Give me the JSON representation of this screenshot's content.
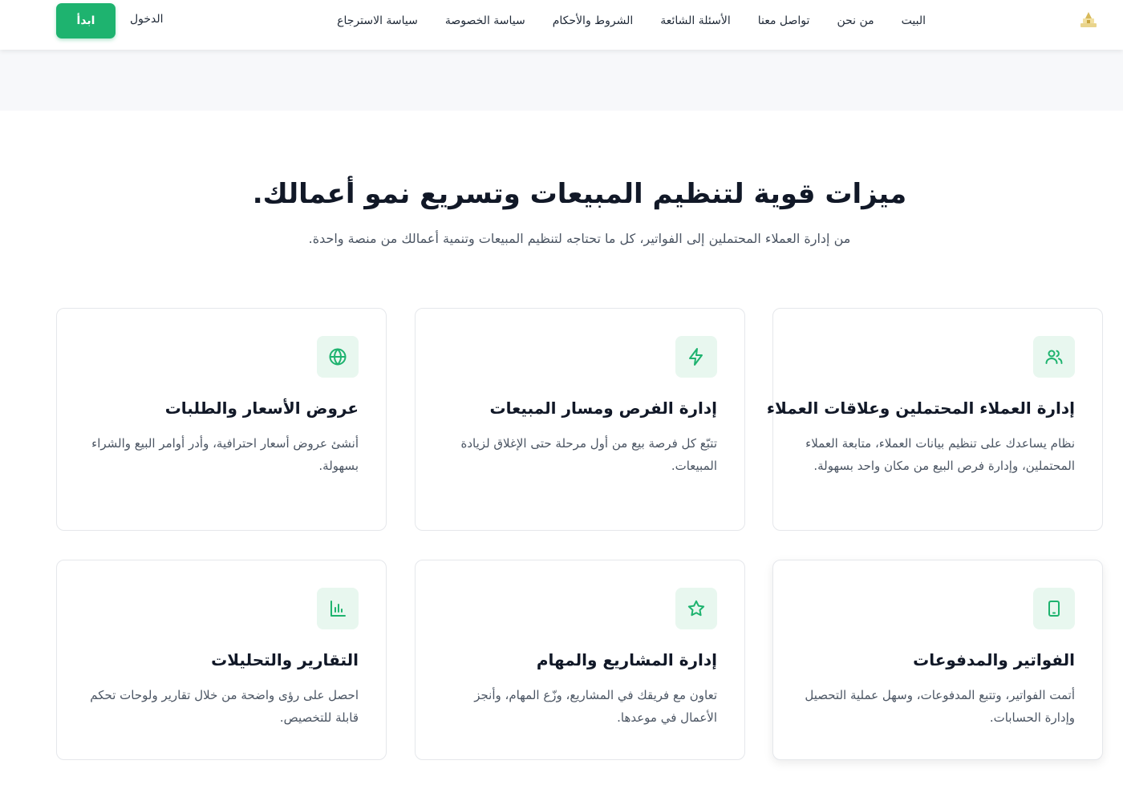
{
  "header": {
    "logo_icon": "logo-icon",
    "nav": [
      "البيت",
      "من نحن",
      "تواصل معنا",
      "الأسئلة الشائعة",
      "الشروط والأحكام",
      "سياسة الخصوصة",
      "سياسة الاسترجاع"
    ],
    "login_label": "الدخول",
    "start_label": "ابدأ"
  },
  "hero": {
    "title": "ميزات قوية لتنظيم المبيعات وتسريع نمو أعمالك.",
    "subtitle": "من إدارة العملاء المحتملين إلى الفواتير، كل ما تحتاجه لتنظيم المبيعات وتنمية أعمالك من منصة واحدة."
  },
  "features": [
    {
      "icon": "users-icon",
      "title": "إدارة العملاء المحتملين وعلاقات العملاء",
      "desc": "نظام يساعدك على تنظيم بيانات العملاء، متابعة العملاء المحتملين، وإدارة فرص البيع من مكان واحد بسهولة."
    },
    {
      "icon": "lightning-icon",
      "title": "إدارة الفرص ومسار المبيعات",
      "desc": "تتبّع كل فرصة بيع من أول مرحلة حتى الإغلاق لزيادة المبيعات."
    },
    {
      "icon": "globe-icon",
      "title": "عروض الأسعار والطلبات",
      "desc": "أنشئ عروض أسعار احترافية، وأدر أوامر البيع والشراء بسهولة."
    },
    {
      "icon": "tablet-icon",
      "title": "الفواتير والمدفوعات",
      "desc": "أتمت الفواتير، وتتبع المدفوعات، وسهل عملية التحصيل وإدارة الحسابات."
    },
    {
      "icon": "star-icon",
      "title": "إدارة المشاريع والمهام",
      "desc": "تعاون مع فريقك في المشاريع، وزّع المهام، وأنجز الأعمال في موعدها."
    },
    {
      "icon": "bar-chart-icon",
      "title": "التقارير والتحليلات",
      "desc": "احصل على رؤى واضحة من خلال تقارير ولوحات تحكم قابلة للتخصيص."
    }
  ],
  "colors": {
    "accent": "#1eb36f",
    "icon_bg": "#e8f7ef"
  }
}
